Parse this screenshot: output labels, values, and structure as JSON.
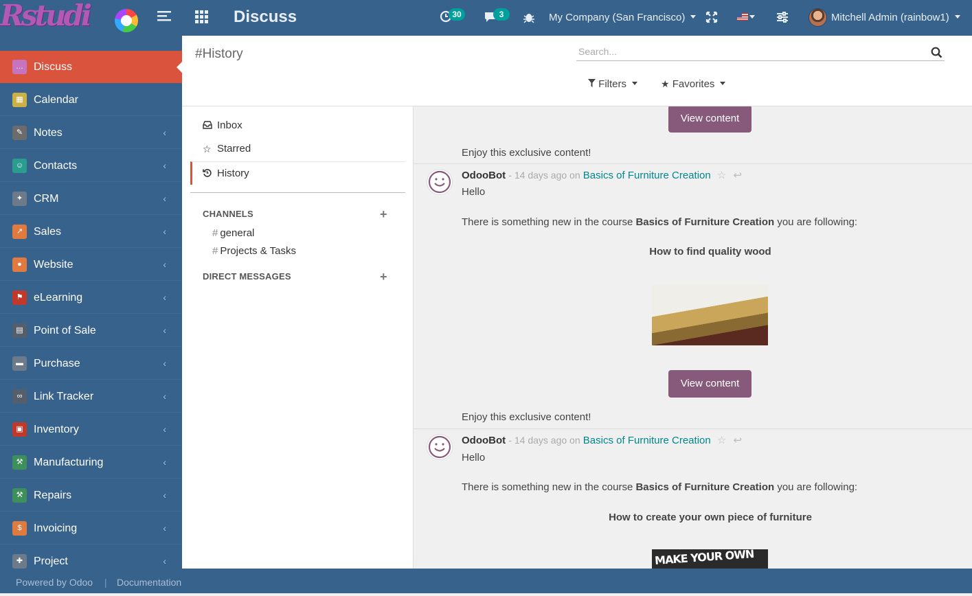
{
  "topbar": {
    "app_title": "Discuss",
    "activity_count": "30",
    "message_count": "3",
    "company": "My Company (San Francisco)",
    "user": "Mitchell Admin (rainbow1)"
  },
  "sidebar": {
    "items": [
      {
        "label": "Discuss",
        "icon": "chat-icon",
        "color": "#c774c0"
      },
      {
        "label": "Calendar",
        "icon": "calendar-icon",
        "color": "#c9b146"
      },
      {
        "label": "Notes",
        "icon": "notes-icon",
        "color": "#6c6c6c"
      },
      {
        "label": "Contacts",
        "icon": "contacts-icon",
        "color": "#2a9d8f"
      },
      {
        "label": "CRM",
        "icon": "crm-icon",
        "color": "#6c7a89"
      },
      {
        "label": "Sales",
        "icon": "sales-icon",
        "color": "#e07a3f"
      },
      {
        "label": "Website",
        "icon": "website-icon",
        "color": "#e07a3f"
      },
      {
        "label": "eLearning",
        "icon": "elearning-icon",
        "color": "#c0392b"
      },
      {
        "label": "Point of Sale",
        "icon": "pos-icon",
        "color": "#555f6b"
      },
      {
        "label": "Purchase",
        "icon": "purchase-icon",
        "color": "#6c7a89"
      },
      {
        "label": "Link Tracker",
        "icon": "link-icon",
        "color": "#555f6b"
      },
      {
        "label": "Inventory",
        "icon": "inventory-icon",
        "color": "#c0392b"
      },
      {
        "label": "Manufacturing",
        "icon": "manufacturing-icon",
        "color": "#3d8f5c"
      },
      {
        "label": "Repairs",
        "icon": "repairs-icon",
        "color": "#3d8f5c"
      },
      {
        "label": "Invoicing",
        "icon": "invoicing-icon",
        "color": "#e07a3f"
      },
      {
        "label": "Project",
        "icon": "project-icon",
        "color": "#6c7a89"
      }
    ]
  },
  "footer": {
    "powered": "Powered by Odoo",
    "documentation": "Documentation"
  },
  "control_panel": {
    "breadcrumb": "#History",
    "search_placeholder": "Search...",
    "filters": "Filters",
    "favorites": "Favorites"
  },
  "discuss": {
    "mailboxes": [
      "Inbox",
      "Starred",
      "History"
    ],
    "channels_label": "CHANNELS",
    "channels": [
      "general",
      "Projects & Tasks"
    ],
    "dm_label": "DIRECT MESSAGES"
  },
  "thread": {
    "view_content": "View content",
    "exclusive": "Enjoy this exclusive content!",
    "author": "OdooBot",
    "age": "- 14 days ago on",
    "record": "Basics of Furniture Creation",
    "hello": "Hello",
    "body_prefix": "There is something new in the course",
    "course": "Basics of Furniture Creation",
    "body_suffix": "you are following:",
    "slide1": "How to find quality wood",
    "slide2": "How to create your own piece of furniture",
    "image2_text": "MAKE YOUR OWN"
  }
}
